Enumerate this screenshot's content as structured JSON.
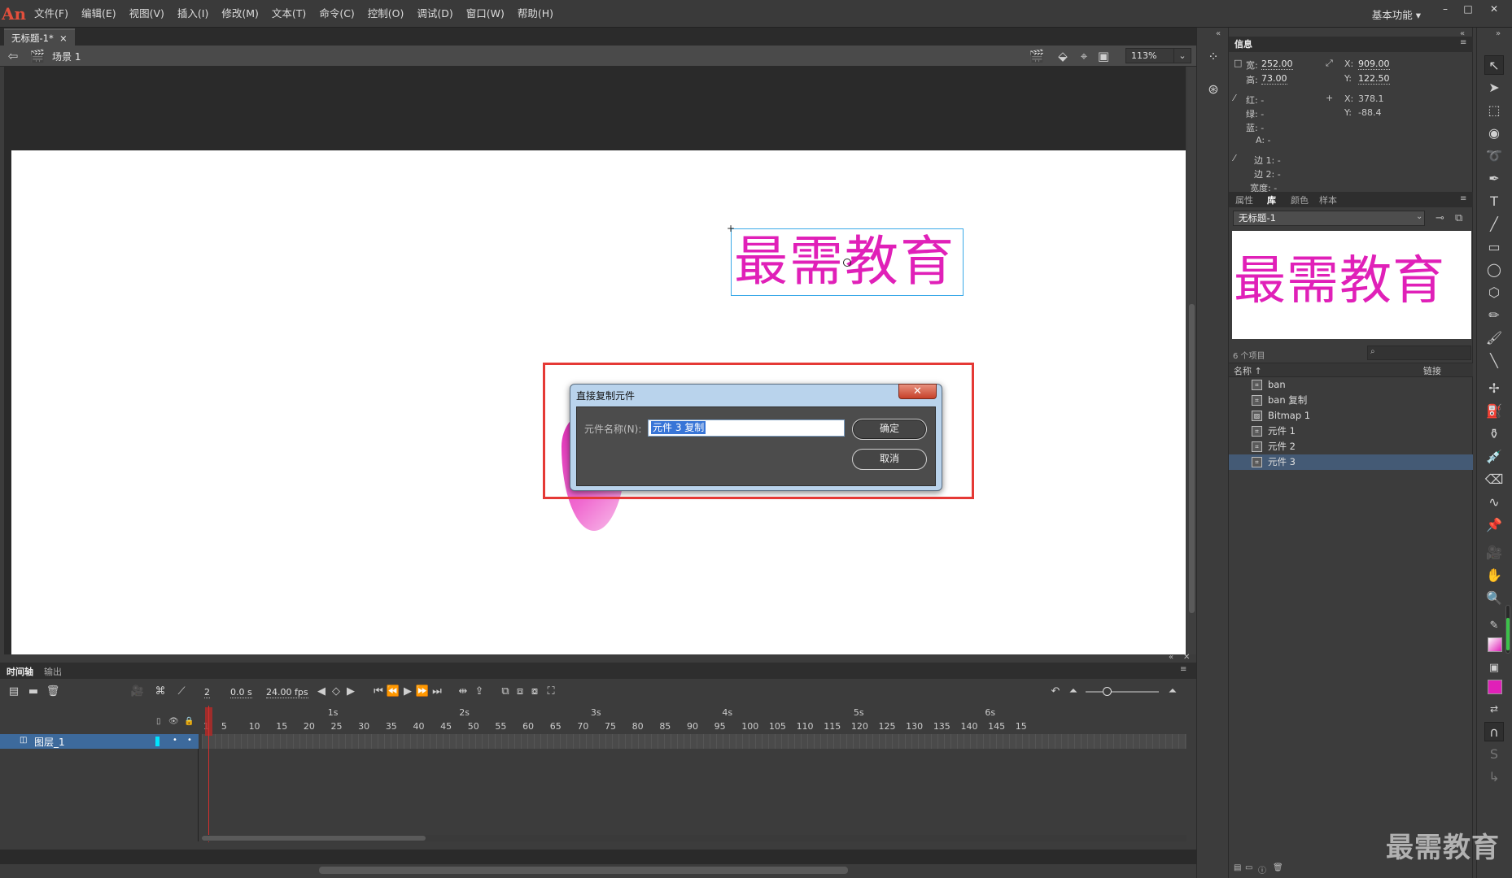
{
  "app": {
    "logo": "An"
  },
  "menu": [
    "文件(F)",
    "编辑(E)",
    "视图(V)",
    "插入(I)",
    "修改(M)",
    "文本(T)",
    "命令(C)",
    "控制(O)",
    "调试(D)",
    "窗口(W)",
    "帮助(H)"
  ],
  "workspace": "基本功能",
  "window_controls": {
    "minimize": "–",
    "maximize": "□",
    "close": "✕"
  },
  "doc_tab": {
    "title": "无标题-1*",
    "close": "×"
  },
  "editbar": {
    "scene": "场景 1",
    "zoom": "113%",
    "zoom_dropdown": "⌄"
  },
  "stage": {
    "text": "最需教育"
  },
  "dialog": {
    "title": "直接复制元件",
    "close": "✕",
    "label": "元件名称(N):",
    "input_value": "元件 3 复制",
    "ok": "确定",
    "cancel": "取消"
  },
  "info_panel": {
    "tab": "信息",
    "w_label": "宽:",
    "w_value": "252.00",
    "h_label": "高:",
    "h_value": "73.00",
    "x_label": "X:",
    "x_value": "909.00",
    "y_label": "Y:",
    "y_value": "122.50",
    "r_label": "红: -",
    "g_label": "绿: -",
    "b_label": "蓝: -",
    "a_label": "A: -",
    "x2_label": "X:",
    "x2_value": "378.1",
    "y2_label": "Y:",
    "y2_value": "-88.4",
    "edge1": "边 1: -",
    "edge2": "边 2: -",
    "width": "宽度: -"
  },
  "library": {
    "tabs": [
      "属性",
      "库",
      "颜色",
      "样本"
    ],
    "doc": "无标题-1",
    "preview_text": "最需教育",
    "count": "6 个项目",
    "col_name": "名称 ↑",
    "col_link": "链接",
    "items": [
      {
        "name": "ban",
        "icon": "graphic-symbol-icon",
        "selected": false
      },
      {
        "name": "ban 复制",
        "icon": "graphic-symbol-icon",
        "selected": false
      },
      {
        "name": "Bitmap 1",
        "icon": "bitmap-icon",
        "selected": false
      },
      {
        "name": "元件 1",
        "icon": "graphic-symbol-icon",
        "selected": false
      },
      {
        "name": "元件 2",
        "icon": "graphic-symbol-icon",
        "selected": false
      },
      {
        "name": "元件 3",
        "icon": "graphic-symbol-icon",
        "selected": true
      }
    ]
  },
  "timeline": {
    "tab1": "时间轴",
    "tab2": "输出",
    "frame": "2",
    "time": "0.0 s",
    "fps": "24.00 fps",
    "layer": "图层_1",
    "ruler_frames": [
      "1",
      "5",
      "10",
      "15",
      "20",
      "25",
      "30",
      "35",
      "40",
      "45",
      "50",
      "55",
      "60",
      "65",
      "70",
      "75",
      "80",
      "85",
      "90",
      "95",
      "100",
      "105",
      "110",
      "115",
      "120",
      "125",
      "130",
      "135",
      "140",
      "145",
      "15"
    ],
    "ruler_seconds": [
      "1s",
      "2s",
      "3s",
      "4s",
      "5s",
      "6s"
    ]
  },
  "watermark": "最需教育",
  "colors": {
    "accent": "#3d6a9c",
    "stage_text": "#e020b8",
    "highlight": "#e53935"
  }
}
